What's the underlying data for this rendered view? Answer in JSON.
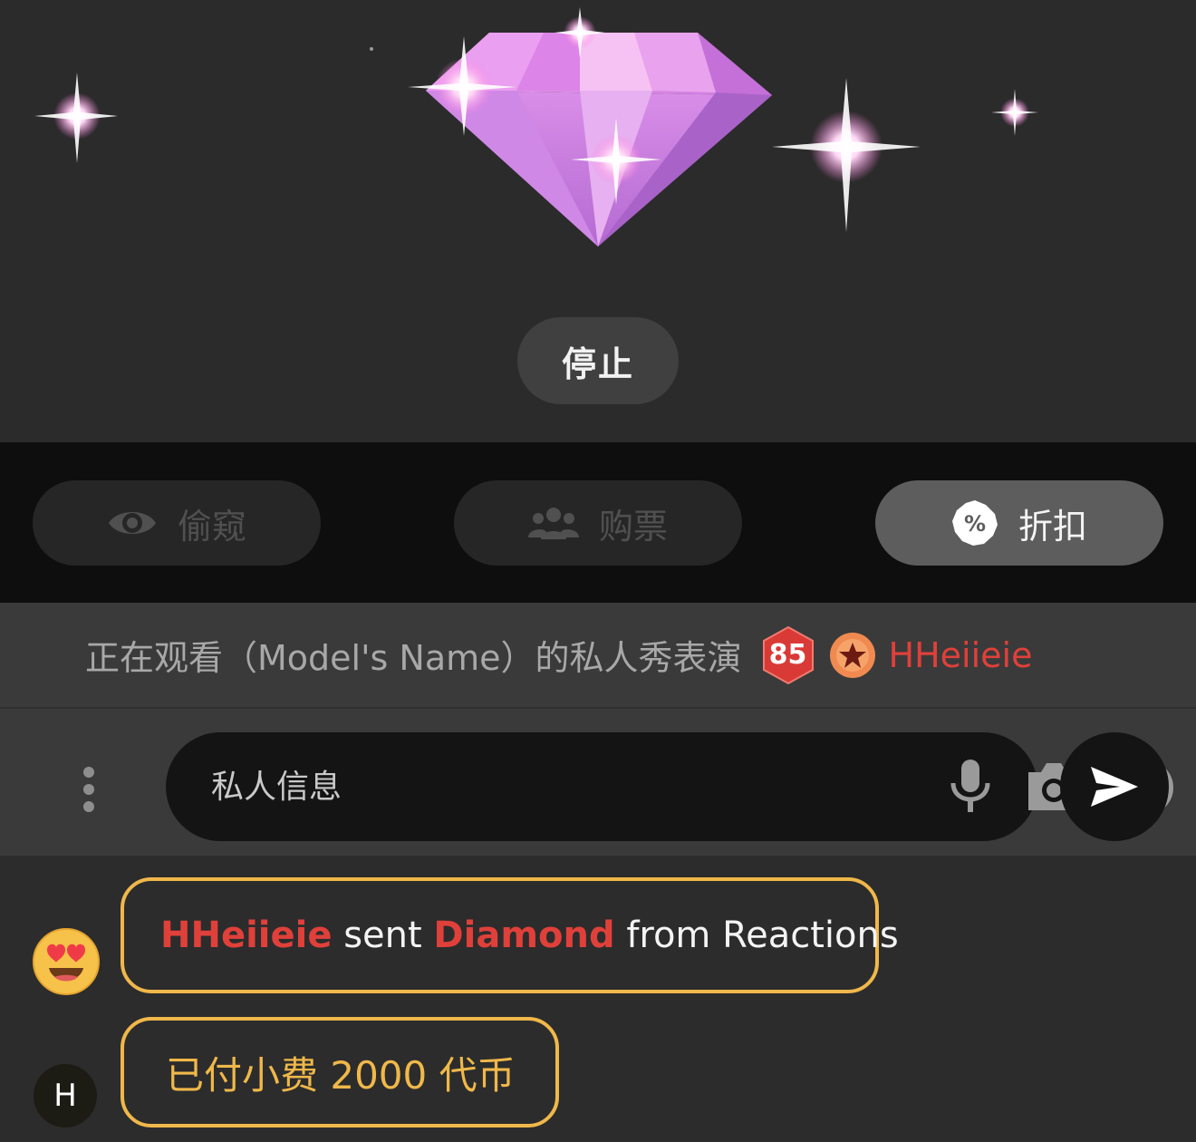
{
  "stage": {
    "animation": "diamond-icon",
    "stop_label": "停止"
  },
  "modes": [
    {
      "label": "偷窥",
      "icon": "eye-icon",
      "state": "disabled"
    },
    {
      "label": "购票",
      "icon": "group-icon",
      "state": "disabled"
    },
    {
      "label": "折扣",
      "icon": "percent-badge-icon",
      "state": "active"
    }
  ],
  "info": {
    "text": "正在观看（Model's Name）的私人秀表演",
    "level": "85",
    "username": "HHeiieie"
  },
  "compose": {
    "placeholder": "私人信息"
  },
  "messages": [
    {
      "avatar": "heart-eyes-emoji",
      "user": "HHeiieie",
      "verb": "sent",
      "item": "Diamond",
      "suffix": "from Reactions"
    },
    {
      "avatar_letter": "H",
      "text": "已付小费 2000 代币"
    }
  ],
  "colors": {
    "accent_red": "#e0403a",
    "tip_gold": "#f0b84a",
    "diamond_pink": "#d77fe6"
  }
}
